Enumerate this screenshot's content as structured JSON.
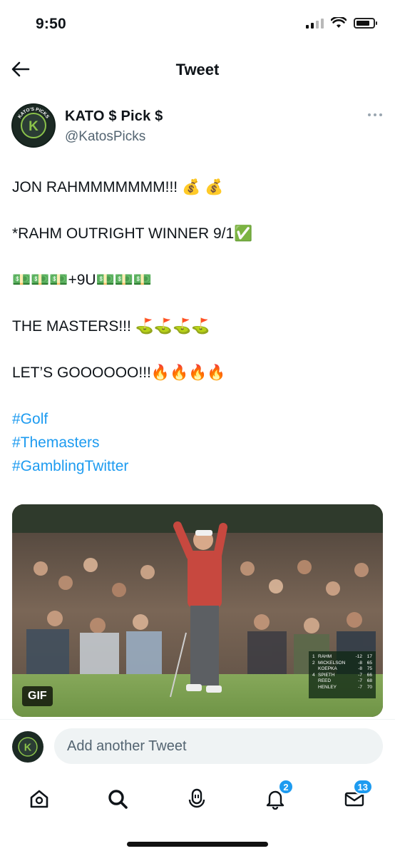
{
  "status_bar": {
    "time": "9:50"
  },
  "header": {
    "title": "Tweet",
    "back_icon": "arrow-left-icon"
  },
  "author": {
    "name": "KATO $ Pick $",
    "handle": "@KatosPicks",
    "avatar_text": "KATO'S PICKS",
    "avatar_letter": "K"
  },
  "tweet": {
    "lines": [
      "JON RAHMMMMMMM!!! 💰 💰",
      "*RAHM OUTRIGHT WINNER 9/1✅",
      "💵💵💵+9U💵💵💵",
      "THE MASTERS!!! ⛳⛳⛳⛳",
      "LET’S GOOOOOO!!!🔥🔥🔥🔥"
    ],
    "hashtags": [
      "#Golf",
      "#Themasters",
      "#GamblingTwitter"
    ]
  },
  "media": {
    "badge": "GIF",
    "leaderboard": [
      {
        "pos": "1",
        "name": "RAHM",
        "score": "-12",
        "today": "17"
      },
      {
        "pos": "2",
        "name": "MICKELSON",
        "score": "-8",
        "today": "65"
      },
      {
        "pos": "",
        "name": "KOEPKA",
        "score": "-8",
        "today": "75"
      },
      {
        "pos": "4",
        "name": "SPIETH",
        "score": "-7",
        "today": "66"
      },
      {
        "pos": "",
        "name": "REED",
        "score": "-7",
        "today": "68"
      },
      {
        "pos": "",
        "name": "HENLEY",
        "score": "-7",
        "today": "70"
      }
    ]
  },
  "reply": {
    "placeholder": "Add another Tweet"
  },
  "tabbar": {
    "notifications_count": "2",
    "messages_count": "13"
  },
  "colors": {
    "accent": "#1d9bf0",
    "text": "#0f1419",
    "secondary": "#536471"
  }
}
